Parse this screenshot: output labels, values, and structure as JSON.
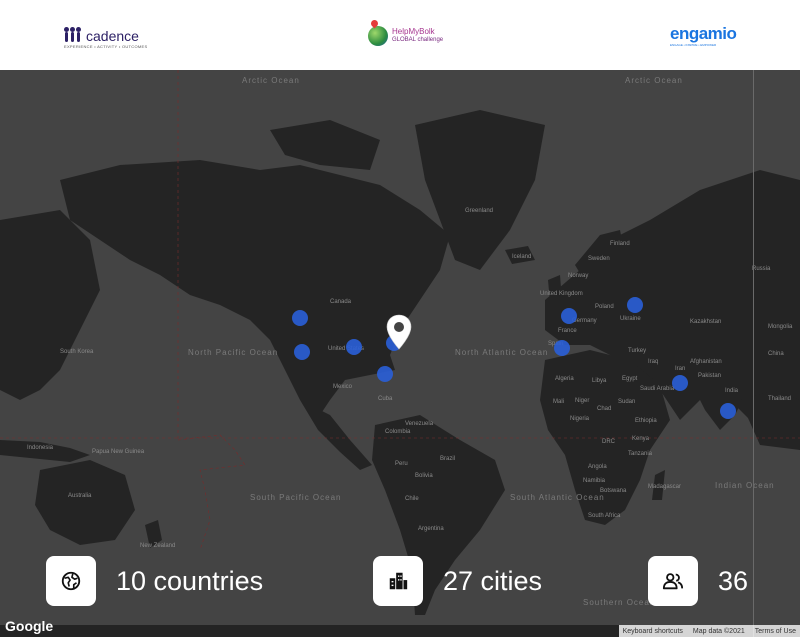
{
  "header": {
    "logos": {
      "cadence": {
        "name": "cadence",
        "sub": "EXPERIENCE • ACTIVITY • OUTCOMES"
      },
      "hmb": {
        "line1": "HelpMyBolk",
        "line2": "GLOBAL challenge"
      },
      "engamio": {
        "name": "engamio",
        "sub": "ENGAGE • INSPIRE • EMPOWER"
      }
    }
  },
  "map": {
    "oceans": {
      "arctic_left": "Arctic Ocean",
      "arctic_right": "Arctic Ocean",
      "north_pacific": "North Pacific Ocean",
      "north_atlantic": "North Atlantic Ocean",
      "south_pacific": "South Pacific Ocean",
      "south_atlantic": "South Atlantic Ocean",
      "indian": "Indian Ocean",
      "southern": "Southern Ocean"
    },
    "labels": [
      "Greenland",
      "Iceland",
      "Canada",
      "United States",
      "Mexico",
      "Cuba",
      "Venezuela",
      "Colombia",
      "Peru",
      "Brazil",
      "Bolivia",
      "Chile",
      "Argentina",
      "Norway",
      "Sweden",
      "Finland",
      "United Kingdom",
      "Germany",
      "France",
      "Spain",
      "Poland",
      "Ukraine",
      "Algeria",
      "Libya",
      "Egypt",
      "Mali",
      "Niger",
      "Chad",
      "Sudan",
      "Nigeria",
      "Ethiopia",
      "DRC",
      "Kenya",
      "Tanzania",
      "Angola",
      "Namibia",
      "Botswana",
      "South Africa",
      "Madagascar",
      "Saudi Arabia",
      "Iran",
      "Iraq",
      "Turkey",
      "Kazakhstan",
      "Afghanistan",
      "Pakistan",
      "India",
      "Russia",
      "Mongolia",
      "China",
      "Thailand",
      "Indonesia",
      "Papua New Guinea",
      "Australia",
      "New Zealand",
      "South Korea"
    ],
    "markers": [
      "Vancouver",
      "Los Angeles",
      "Chicago",
      "New York",
      "Miami",
      "London",
      "Madrid",
      "Kyiv",
      "Dubai",
      "Sri Lanka"
    ],
    "attribution": {
      "google": "Google",
      "shortcuts": "Keyboard shortcuts",
      "mapdata": "Map data ©2021",
      "terms": "Terms of Use"
    }
  },
  "stats": {
    "countries": "10 countries",
    "cities": "27 cities",
    "people": "36"
  },
  "colors": {
    "marker": "#2a5fd8",
    "map_water": "#444444",
    "map_land": "#242424",
    "engamio_blue": "#1a75e0"
  }
}
